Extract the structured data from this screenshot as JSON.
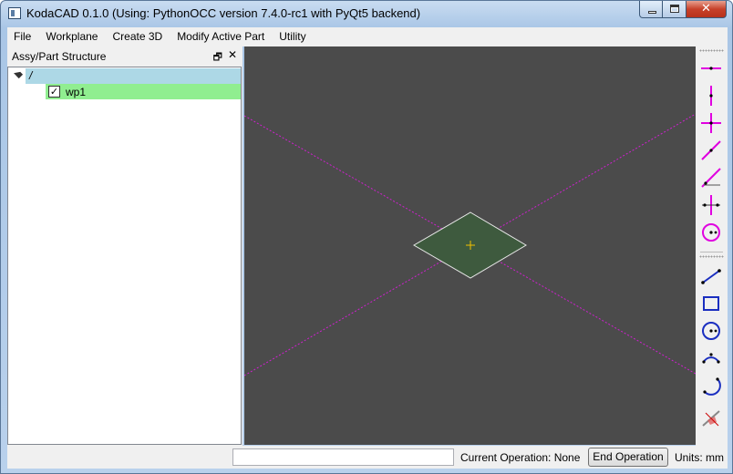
{
  "window": {
    "title": "KodaCAD 0.1.0 (Using: PythonOCC version 7.4.0-rc1 with PyQt5 backend)",
    "close_glyph": "✕"
  },
  "menubar": {
    "items": [
      "File",
      "Workplane",
      "Create 3D",
      "Modify Active Part",
      "Utility"
    ]
  },
  "dock": {
    "title": "Assy/Part Structure",
    "float_glyph": "🗗",
    "close_glyph": "✕",
    "tree": {
      "root_label": "/",
      "child_label": "wp1",
      "child_checked": true,
      "check_glyph": "✓"
    }
  },
  "viewport": {
    "background": "#4b4b4b",
    "construction_line_color": "#d020d0",
    "workplane_fill": "#3e5a3e",
    "workplane_edge": "#e8e8e8",
    "origin_marker_color": "#f0c000"
  },
  "toolbar": {
    "groups": [
      [
        "horizontal-cline-icon",
        "vertical-cline-icon",
        "horiz-vert-cline-icon",
        "angled-cline-icon",
        "ref-angle-cline-icon",
        "bisector-cline-icon",
        "circle-cline-icon"
      ],
      [
        "line-icon",
        "rectangle-icon",
        "circle-icon",
        "arc-three-point-icon",
        "arc-center-icon"
      ],
      [
        "delete-element-icon"
      ]
    ]
  },
  "statusbar": {
    "command_value": "",
    "current_operation": "Current Operation: None",
    "end_operation_label": "End Operation",
    "units": "Units: mm"
  }
}
